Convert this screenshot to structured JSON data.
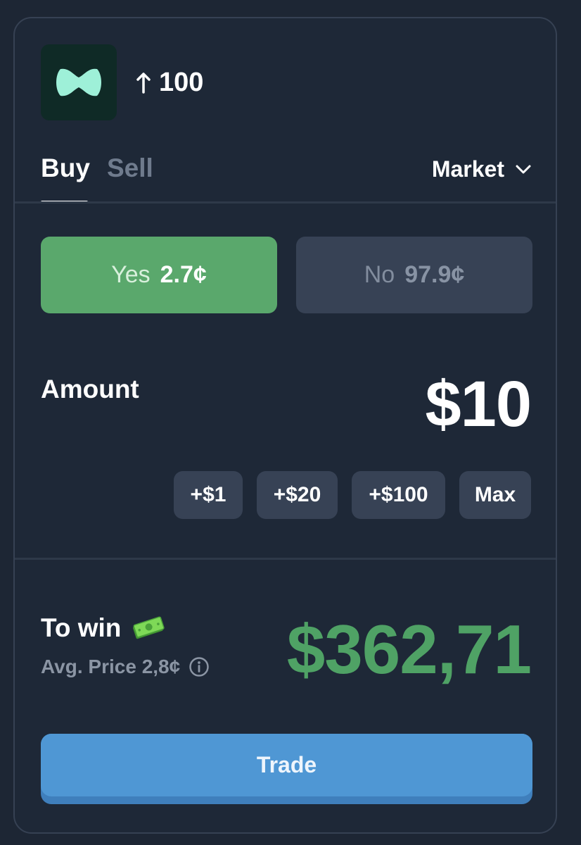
{
  "colors": {
    "background": "#1e2837",
    "yes_green": "#5aa86c",
    "win_green": "#4fa265",
    "trade_blue": "#4f97d4",
    "muted_button": "#374255"
  },
  "header": {
    "logo_icon": "market-logo-icon",
    "direction_icon": "arrow-up-icon",
    "value": "100"
  },
  "tabs": [
    {
      "label": "Buy",
      "active": true
    },
    {
      "label": "Sell",
      "active": false
    }
  ],
  "order_type": {
    "label": "Market",
    "icon": "chevron-down-icon"
  },
  "outcomes": {
    "yes": {
      "label": "Yes",
      "price": "2.7¢",
      "selected": true
    },
    "no": {
      "label": "No",
      "price": "97.9¢",
      "selected": false
    }
  },
  "amount": {
    "label": "Amount",
    "value": "$10",
    "quick_buttons": [
      "+$1",
      "+$20",
      "+$100",
      "Max"
    ]
  },
  "payout": {
    "label": "To win",
    "icon": "money-icon",
    "avg_price": "Avg. Price 2,8¢",
    "info_icon": "info-icon",
    "value": "$362,71"
  },
  "action": {
    "label": "Trade"
  }
}
